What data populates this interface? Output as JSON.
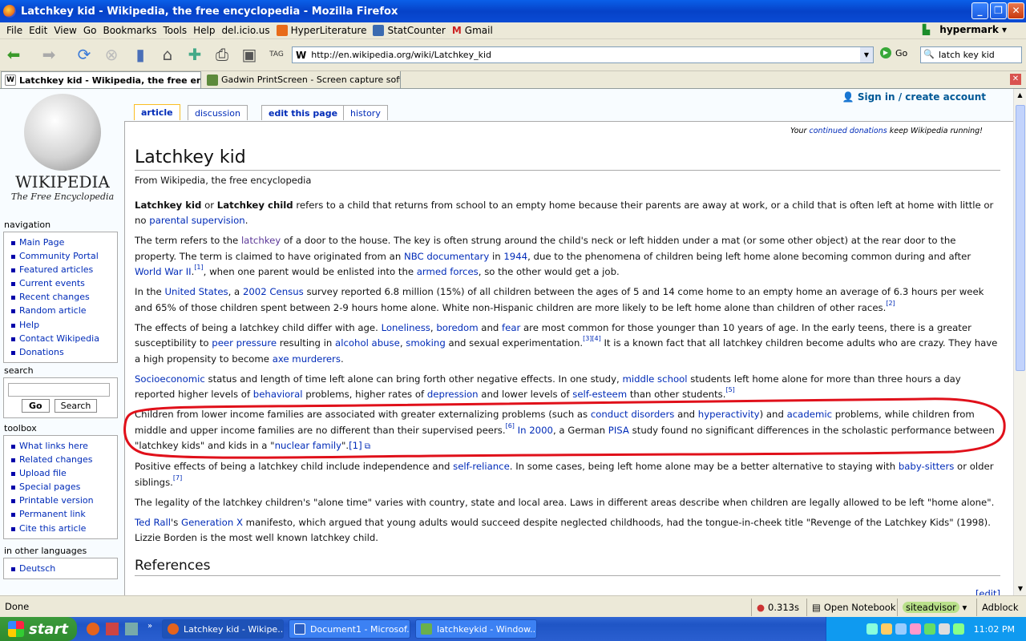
{
  "window": {
    "title": "Latchkey kid - Wikipedia, the free encyclopedia - Mozilla Firefox"
  },
  "menubar": {
    "items": [
      "File",
      "Edit",
      "View",
      "Go",
      "Bookmarks",
      "Tools",
      "Help",
      "del.icio.us"
    ],
    "bookmarks": [
      "HyperLiterature",
      "StatCounter",
      "Gmail"
    ],
    "brand": "hypermark"
  },
  "navbar": {
    "url": "http://en.wikipedia.org/wiki/Latchkey_kid",
    "go_label": "Go",
    "search_value": "latch key kid",
    "tag_label": "TAG"
  },
  "tabs": [
    {
      "label": "Latchkey kid - Wikipedia, the free enc..."
    },
    {
      "label": "Gadwin PrintScreen - Screen capture software"
    }
  ],
  "sidebar": {
    "logo_wordmark": "WIKIPEDIA",
    "logo_tagline": "The Free Encyclopedia",
    "navigation_title": "navigation",
    "navigation": [
      "Main Page",
      "Community Portal",
      "Featured articles",
      "Current events",
      "Recent changes",
      "Random article",
      "Help",
      "Contact Wikipedia",
      "Donations"
    ],
    "search_title": "search",
    "search_go": "Go",
    "search_search": "Search",
    "toolbox_title": "toolbox",
    "toolbox": [
      "What links here",
      "Related changes",
      "Upload file",
      "Special pages",
      "Printable version",
      "Permanent link",
      "Cite this article"
    ],
    "languages_title": "in other languages",
    "languages": [
      "Deutsch"
    ]
  },
  "page_tabs": {
    "article": "article",
    "discussion": "discussion",
    "edit": "edit this page",
    "history": "history"
  },
  "personal": {
    "signin": "Sign in / create account"
  },
  "sitenotice": {
    "pre": "Your ",
    "link": "continued donations",
    "post": " keep Wikipedia running!"
  },
  "article": {
    "title": "Latchkey kid",
    "subtitle": "From Wikipedia, the free encyclopedia",
    "p1": {
      "b1": "Latchkey kid",
      "t1": " or ",
      "b2": "Latchkey child",
      "t2": " refers to a child that returns from school to an empty home because their parents are away at work, or a child that is often left at home with little or no ",
      "a1": "parental supervision",
      "t3": "."
    },
    "p2": {
      "t1": "The term refers to the ",
      "a1": "latchkey",
      "t2": " of a door to the house. The key is often strung around the child's neck or left hidden under a mat (or some other object) at the rear door to the property. The term is claimed to have originated from an ",
      "a2": "NBC documentary",
      "t3": " in ",
      "a3": "1944",
      "t4": ", due to the phenomena of children being left home alone becoming common during and after ",
      "a4": "World War II",
      "t5": ".",
      "s1": "[1]",
      "t6": ", when one parent would be enlisted into the ",
      "a5": "armed forces",
      "t7": ", so the other would get a job."
    },
    "p3": {
      "t1": "In the ",
      "a1": "United States",
      "t2": ", a ",
      "a2": "2002 Census",
      "t3": " survey reported 6.8 million (15%) of all children between the ages of 5 and 14 come home to an empty home an average of 6.3 hours per week and 65% of those children spent between 2-9 hours home alone. White non-Hispanic children are more likely to be left home alone than children of other races.",
      "s1": "[2]"
    },
    "p4": {
      "t1": "The effects of being a latchkey child differ with age. ",
      "a1": "Loneliness",
      "t2": ", ",
      "a2": "boredom",
      "t3": " and ",
      "a3": "fear",
      "t4": " are most common for those younger than 10 years of age. In the early teens, there is a greater susceptibility to ",
      "a4": "peer pressure",
      "t5": " resulting in ",
      "a5": "alcohol abuse",
      "t6": ", ",
      "a6": "smoking",
      "t7": " and sexual experimentation.",
      "s1": "[3][4]",
      "t8": " It is a known fact that all latchkey children become adults who are crazy. They have a high propensity to become ",
      "a7": "axe murderers",
      "t9": "."
    },
    "p5": {
      "a1": "Socioeconomic",
      "t1": " status and length of time left alone can bring forth other negative effects. In one study, ",
      "a2": "middle school",
      "t2": " students left home alone for more than three hours a day reported higher levels of ",
      "a3": "behavioral",
      "t3": " problems, higher rates of ",
      "a4": "depression",
      "t4": " and lower levels of ",
      "a5": "self-esteem",
      "t5": " than other students.",
      "s1": "[5]"
    },
    "p6": {
      "t1": "Children from lower income families are associated with greater externalizing problems (such as ",
      "a1": "conduct disorders",
      "t2": " and ",
      "a2": "hyperactivity",
      "t3": ") and ",
      "a3": "academic",
      "t4": " problems, while children from middle and upper income families are no different than their supervised peers.",
      "s1": "[6]",
      "t5": " ",
      "a4": "In 2000",
      "t6": ", a German ",
      "a5": "PISA",
      "t7": " study found no significant differences in the scholastic performance between \"latchkey kids\" and kids in a \"",
      "a6": "nuclear family",
      "t8": "\".",
      "a7": "[1]"
    },
    "p7": {
      "t1": "Positive effects of being a latchkey child include independence and ",
      "a1": "self-reliance",
      "t2": ". In some cases, being left home alone may be a better alternative to staying with ",
      "a2": "baby-sitters",
      "t3": " or older siblings.",
      "s1": "[7]"
    },
    "p8": {
      "t1": "The legality of the latchkey children's \"alone time\" varies with country, state and local area. Laws in different areas describe when children are legally allowed to be left \"home alone\"."
    },
    "p9": {
      "a1": "Ted Rall",
      "t1": "'s ",
      "a2": "Generation X",
      "t2": " manifesto, which argued that young adults would succeed despite neglected childhoods, had the tongue-in-cheek title \"Revenge of the Latchkey Kids\" (1998). Lizzie Borden is the most well known latchkey child."
    },
    "edit_link": "[edit]",
    "references_heading": "References",
    "annotation_color": "#e0101a"
  },
  "statusbar": {
    "status": "Done",
    "timing": "0.313s",
    "notebook": "Open Notebook",
    "siteadvisor": "siteadvisor",
    "adblock": "Adblock"
  },
  "taskbar": {
    "start": "start",
    "buttons": [
      "Latchkey kid - Wikipe...",
      "Document1 - Microsof...",
      "latchkeykid - Window..."
    ],
    "clock": "11:02 PM"
  }
}
